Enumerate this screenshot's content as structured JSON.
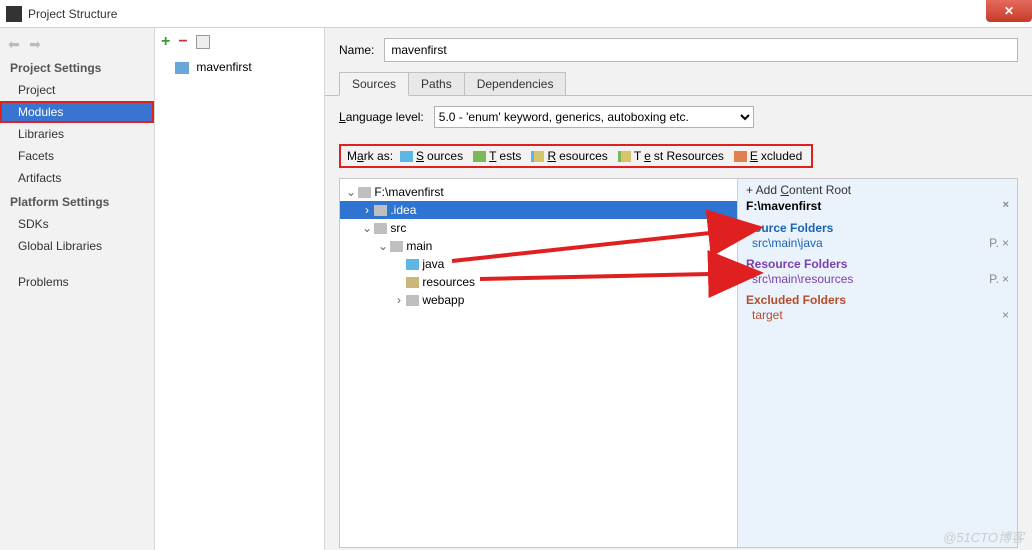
{
  "window": {
    "title": "Project Structure"
  },
  "sidebar": {
    "group1_title": "Project Settings",
    "items1": [
      "Project",
      "Modules",
      "Libraries",
      "Facets",
      "Artifacts"
    ],
    "group2_title": "Platform Settings",
    "items2": [
      "SDKs",
      "Global Libraries"
    ],
    "items3": [
      "Problems"
    ]
  },
  "modules": {
    "list": [
      {
        "name": "mavenfirst"
      }
    ]
  },
  "name_field": {
    "label": "Name:",
    "value": "mavenfirst"
  },
  "tabs": [
    "Sources",
    "Paths",
    "Dependencies"
  ],
  "language": {
    "label": "Language level:",
    "value": "5.0 - 'enum' keyword, generics, autoboxing etc."
  },
  "mark": {
    "label": "Mark as:",
    "sources": "Sources",
    "tests": "Tests",
    "resources": "Resources",
    "test_resources": "Test Resources",
    "excluded": "Excluded"
  },
  "tree": {
    "root": "F:\\mavenfirst",
    "idea": ".idea",
    "src": "src",
    "main": "main",
    "java": "java",
    "resources": "resources",
    "webapp": "webapp"
  },
  "right": {
    "add_root": "+ Add Content Root",
    "root_path": "F:\\mavenfirst",
    "src_head": "Source Folders",
    "src_path": "src\\main\\java",
    "res_head": "Resource Folders",
    "res_path": "src\\main\\resources",
    "exc_head": "Excluded Folders",
    "exc_path": "target"
  },
  "watermark": "@51CTO博客"
}
